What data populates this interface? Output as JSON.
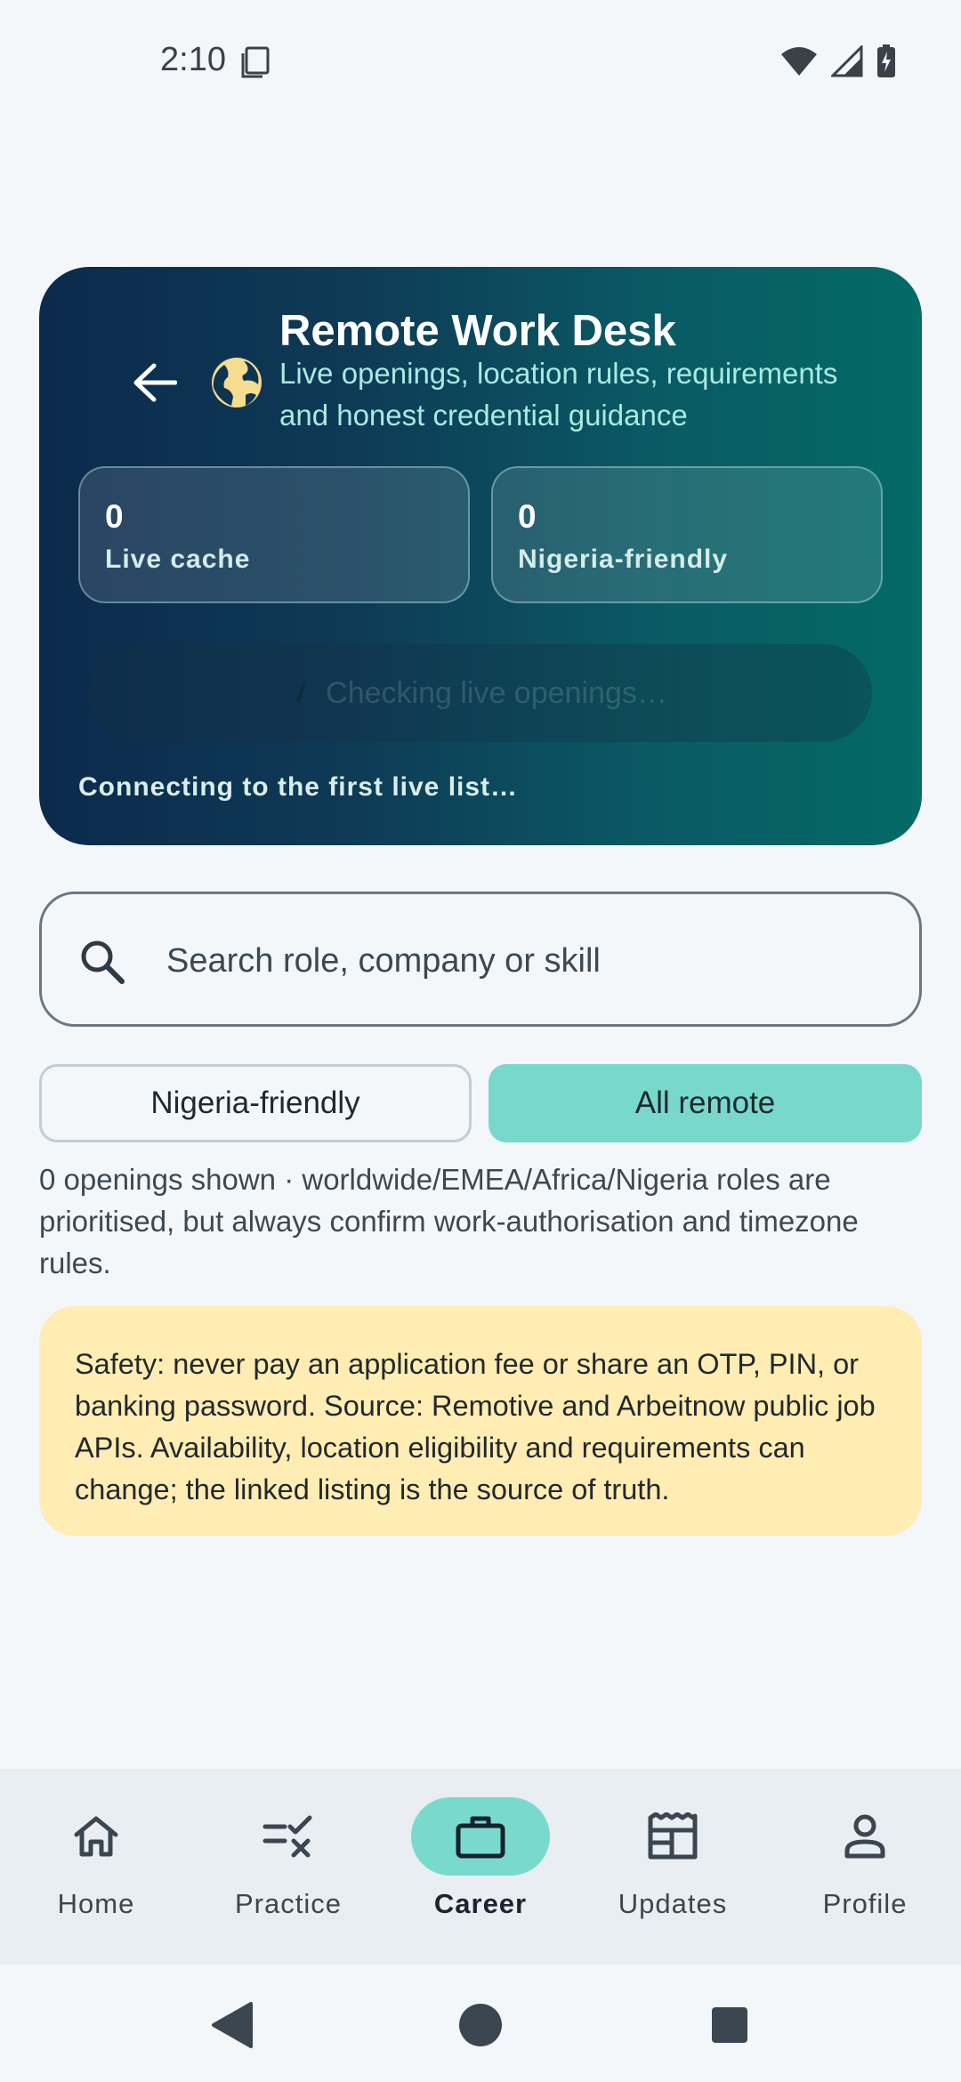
{
  "status_bar": {
    "time": "2:10"
  },
  "hero": {
    "title": "Remote Work Desk",
    "subtitle": "Live openings, location rules, requirements and honest credential guidance",
    "stats": [
      {
        "value": "0",
        "label": "Live cache"
      },
      {
        "value": "0",
        "label": "Nigeria-friendly"
      }
    ],
    "checking_text": "Checking live openings…",
    "connecting_text": "Connecting to the first live list…"
  },
  "search": {
    "placeholder": "Search role, company or skill"
  },
  "filters": {
    "nigeria_label": "Nigeria-friendly",
    "all_label": "All remote",
    "selected": "All remote"
  },
  "info_text": "0 openings shown · worldwide/EMEA/Africa/Nigeria roles are prioritised, but always confirm work-authorisation and timezone rules.",
  "safety_text": "Safety: never pay an application fee or share an OTP, PIN, or banking password. Source: Remotive and Arbeitnow public job APIs. Availability, location eligibility and requirements can change; the linked listing is the source of truth.",
  "bottom_nav": {
    "items": [
      {
        "label": "Home",
        "icon": "home-icon"
      },
      {
        "label": "Practice",
        "icon": "practice-icon"
      },
      {
        "label": "Career",
        "icon": "briefcase-icon",
        "active": true
      },
      {
        "label": "Updates",
        "icon": "newspaper-icon"
      },
      {
        "label": "Profile",
        "icon": "person-icon"
      }
    ]
  },
  "colors": {
    "hero_gradient_start": "#0c2a4c",
    "hero_gradient_end": "#036a66",
    "accent": "#78d8cc",
    "safety_bg": "#ffedb3",
    "subtitle_teal": "#a9e9e0"
  }
}
